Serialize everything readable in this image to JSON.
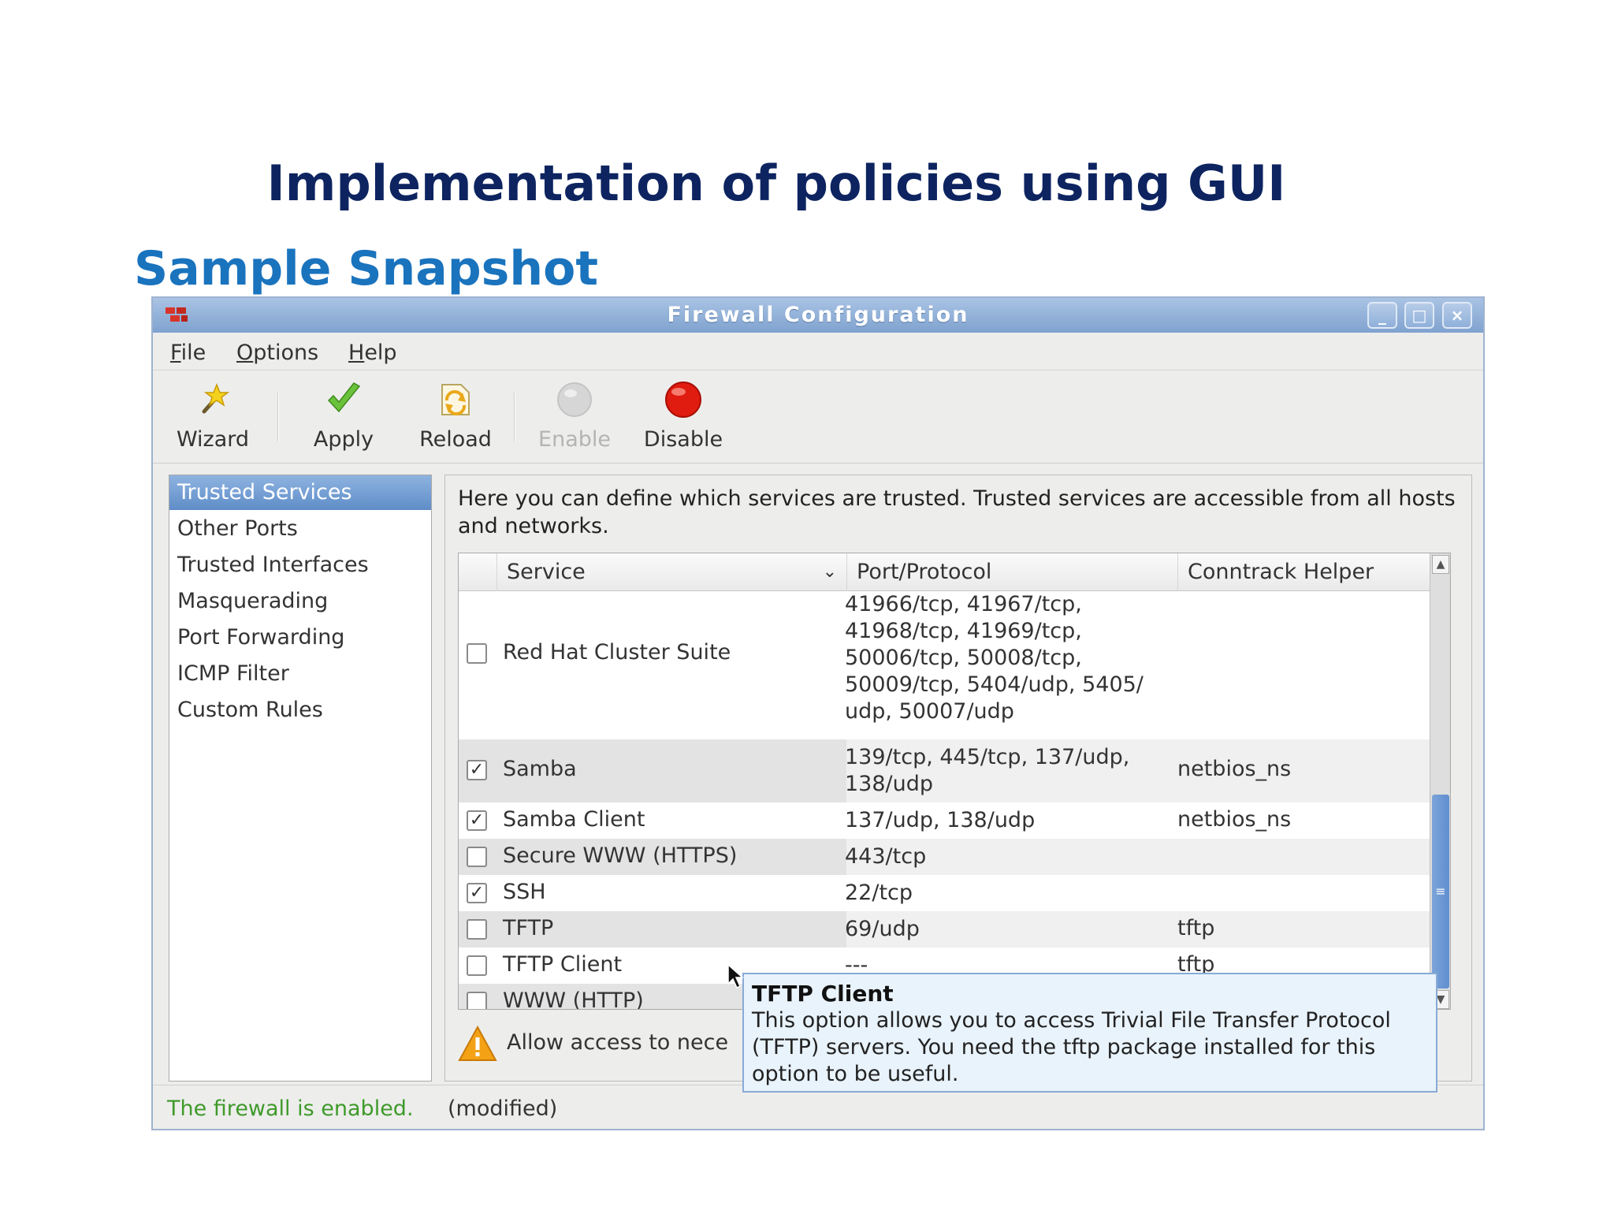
{
  "slide": {
    "title": "Implementation of policies using GUI",
    "subtitle": "Sample Snapshot"
  },
  "window": {
    "title": "Firewall Configuration",
    "controls": {
      "minimize": "_",
      "maximize": "□",
      "close": "×"
    }
  },
  "menu": [
    {
      "mnemonic": "F",
      "rest": "ile"
    },
    {
      "mnemonic": "O",
      "rest": "ptions"
    },
    {
      "mnemonic": "H",
      "rest": "elp"
    }
  ],
  "toolbar": {
    "wizard": {
      "label": "Wizard",
      "icon": "wand-icon"
    },
    "apply": {
      "label": "Apply",
      "icon": "checkmark-icon"
    },
    "reload": {
      "label": "Reload",
      "icon": "reload-icon"
    },
    "enable": {
      "label": "Enable",
      "icon": "gray-circle-icon",
      "disabled": true
    },
    "disable": {
      "label": "Disable",
      "icon": "red-circle-icon"
    }
  },
  "sidebar": {
    "items": [
      {
        "label": "Trusted Services",
        "selected": true
      },
      {
        "label": "Other Ports"
      },
      {
        "label": "Trusted Interfaces"
      },
      {
        "label": "Masquerading"
      },
      {
        "label": "Port Forwarding"
      },
      {
        "label": "ICMP Filter"
      },
      {
        "label": "Custom Rules"
      }
    ]
  },
  "content": {
    "description": "Here you can define which services are trusted. Trusted services are accessible from all hosts and networks.",
    "table": {
      "headers": {
        "service": "Service",
        "port": "Port/Protocol",
        "helper": "Conntrack Helper",
        "sort_icon": "⌄"
      },
      "rows": [
        {
          "service": "Red Hat Cluster Suite",
          "checked": false,
          "port_lines": [
            "41966/tcp, 41967/tcp,",
            "41968/tcp, 41969/tcp,",
            "50006/tcp, 50008/tcp,",
            "50009/tcp, 5404/udp, 5405/",
            "udp, 50007/udp"
          ],
          "helper": ""
        },
        {
          "service": "Samba",
          "checked": true,
          "port_lines": [
            "139/tcp, 445/tcp, 137/udp,",
            "138/udp"
          ],
          "helper": "netbios_ns"
        },
        {
          "service": "Samba Client",
          "checked": true,
          "port_lines": [
            "137/udp, 138/udp"
          ],
          "helper": "netbios_ns"
        },
        {
          "service": "Secure WWW (HTTPS)",
          "checked": false,
          "port_lines": [
            "443/tcp"
          ],
          "helper": ""
        },
        {
          "service": "SSH",
          "checked": true,
          "port_lines": [
            "22/tcp"
          ],
          "helper": ""
        },
        {
          "service": "TFTP",
          "checked": false,
          "port_lines": [
            "69/udp"
          ],
          "helper": "tftp"
        },
        {
          "service": "TFTP Client",
          "checked": false,
          "port_lines": [
            "---"
          ],
          "helper": "tftp"
        },
        {
          "service": "WWW (HTTP)",
          "checked": false,
          "port_lines": [],
          "helper": ""
        }
      ]
    },
    "warning": "Allow access to nece"
  },
  "status": {
    "state": "The firewall is enabled.",
    "modified": "(modified)"
  },
  "tooltip": {
    "title": "TFTP Client",
    "body": "This option allows you to access Trivial File Transfer Protocol (TFTP) servers. You need the tftp package installed for this option to be useful."
  },
  "colors": {
    "title_navy": "#0d2460",
    "subtitle_blue": "#1a73bd",
    "selection_blue": "#5f8dc8",
    "status_green": "#3f9a2a",
    "tooltip_bg": "#e9f3fc"
  }
}
